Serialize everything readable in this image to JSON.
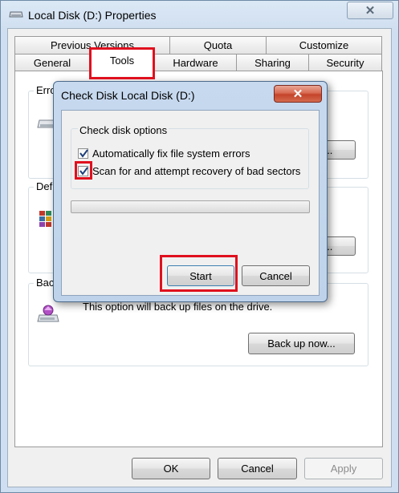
{
  "window": {
    "title": "Local Disk (D:) Properties",
    "close_glyph": "✕"
  },
  "tabs": {
    "row1": [
      "Previous Versions",
      "Quota",
      "Customize"
    ],
    "row2": [
      "General",
      "Tools",
      "Hardware",
      "Sharing",
      "Security"
    ],
    "active": "Tools"
  },
  "tools_panel": {
    "error_checking_label": "Erro",
    "defrag_label": "Def",
    "backup_label": "Bac",
    "backup_description": "This option will back up files on the drive.",
    "check_now_button": "...",
    "defrag_button": "...",
    "backup_button": "Back up now..."
  },
  "dialog": {
    "title": "Check Disk Local Disk (D:)",
    "close_glyph": "✕",
    "options_label": "Check disk options",
    "option1": {
      "label": "Automatically fix file system errors",
      "checked": true
    },
    "option2": {
      "label": "Scan for and attempt recovery of bad sectors",
      "checked": true
    },
    "progress": 0,
    "start_button": "Start",
    "cancel_button": "Cancel"
  },
  "footer": {
    "ok_button": "OK",
    "cancel_button": "Cancel",
    "apply_button": "Apply"
  },
  "colors": {
    "highlight": "#e0101e",
    "dialog_close": "#c4432a"
  }
}
